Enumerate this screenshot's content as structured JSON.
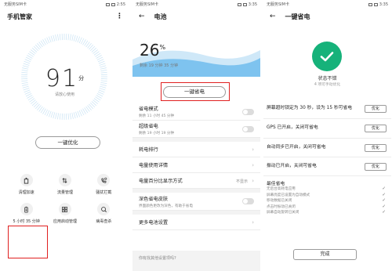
{
  "panel1": {
    "status": {
      "carrier": "无服务SIM卡",
      "time": "2:55"
    },
    "title": "手机管家",
    "menu_icon": "more-vert-icon",
    "score": "91",
    "score_unit": "分",
    "score_caption": "请放心使用",
    "optimize_label": "一键优化",
    "grid": [
      {
        "icon": "cleanup-icon",
        "label": "清理加速"
      },
      {
        "icon": "data-icon",
        "label": "流量管理"
      },
      {
        "icon": "block-icon",
        "label": "骚扰拦截"
      },
      {
        "icon": "battery-icon",
        "label": "5 小时 35 分钟"
      },
      {
        "icon": "apps-icon",
        "label": "应用启动管理"
      },
      {
        "icon": "virus-scan-icon",
        "label": "病毒查杀"
      }
    ]
  },
  "panel2": {
    "status": {
      "carrier": "无服务SIM卡",
      "time": "3:35"
    },
    "title": "电池",
    "percent": "26",
    "percent_sym": "%",
    "remain": "剩余 19 分钟 35 分钟",
    "oneclick_label": "一键省电",
    "rows": [
      {
        "title": "省电模式",
        "sub": "剩余 11 小时 45 分钟",
        "control": "toggle"
      },
      {
        "title": "超级省电",
        "sub": "剩余 19 小时 19 分钟",
        "control": "toggle"
      },
      {
        "title": "耗电排行",
        "sub": "",
        "control": "chevron"
      },
      {
        "title": "电量使用详情",
        "sub": "",
        "control": "chevron"
      },
      {
        "title": "电量百分比显示方式",
        "sub": "",
        "control": "value",
        "value": "不显示"
      },
      {
        "title": "深色省电皮肤",
        "sub": "界面颜色更改为深色，有助于省电",
        "control": "toggle"
      },
      {
        "title": "更多电池设置",
        "sub": "",
        "control": "chevron"
      }
    ],
    "footer_question": "你有找其他设置项吗?"
  },
  "panel3": {
    "status": {
      "carrier": "无服务SIM卡",
      "time": "3:35"
    },
    "title": "一键省电",
    "status_title": "状态不错",
    "status_sub": "4 项可手动优化",
    "items": [
      {
        "text": "屏幕超时锁定为 30 秒，设为 15 秒可省电",
        "button": "优化"
      },
      {
        "text": "GPS 已开启，关闭可省电",
        "button": "优化"
      },
      {
        "text": "自动同步已开启，关闭可省电",
        "button": "优化"
      },
      {
        "text": "振动已开启，关闭可省电",
        "button": "优化"
      }
    ],
    "best_title": "最佳省电",
    "best_items": [
      "无后台高耗电应用",
      "屏幕亮度已设置为自动模式",
      "移动数据已关闭",
      "点击时振动已关闭",
      "屏幕自动旋转已关闭"
    ],
    "done_label": "完成"
  },
  "colors": {
    "accent_green": "#16b27a",
    "highlight_red": "#e02020",
    "wave_blue": "#7ec3ef"
  }
}
